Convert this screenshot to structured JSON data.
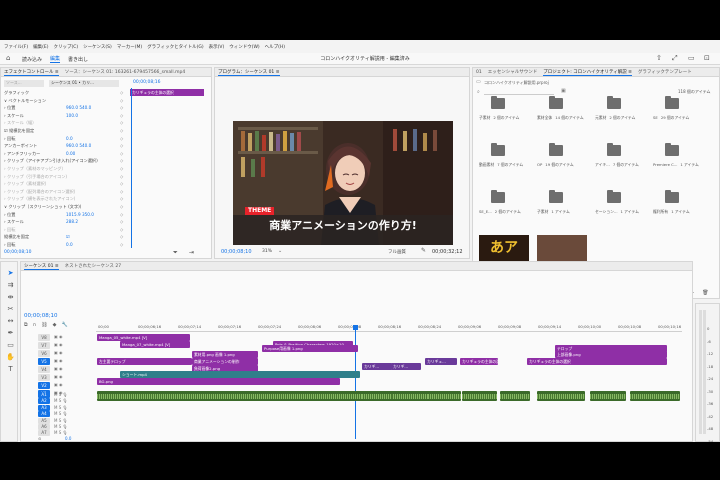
{
  "menu": [
    "ファイル(F)",
    "編集(E)",
    "クリップ(C)",
    "シーケンス(S)",
    "マーカー(M)",
    "グラフィックとタイトル(G)",
    "表示(V)",
    "ウィンドウ(W)",
    "ヘルプ(H)"
  ],
  "workspace_tabs": [
    "読み込み",
    "編集",
    "書き出し"
  ],
  "workspace_active": "編集",
  "document_title": "コロンハイクオリティ解説用 - 編集済み",
  "effect_controls": {
    "tabs": [
      "エフェクトコントロール ≡",
      "ソース：シーケンス 01: 163261-679457566_small.mp4"
    ],
    "sequence_chip": "シーケンス 01 • カリ...",
    "source_chip": "ソース...",
    "timecode": "00;00;08;16",
    "clip_bar_label": "カリギュラの主体の選択",
    "rows": [
      {
        "label": "グラフィック",
        "value": "",
        "dim": false
      },
      {
        "label": "∨ ベクトルモーション",
        "value": "",
        "dim": false
      },
      {
        "label": "  › 位置",
        "value": "960.0   540.0",
        "dim": false
      },
      {
        "label": "  › スケール",
        "value": "100.0",
        "dim": false
      },
      {
        "label": "  › スケール（幅）",
        "value": "",
        "dim": true
      },
      {
        "label": "     ☑ 縦横比を固定",
        "value": "",
        "dim": false
      },
      {
        "label": "  › 回転",
        "value": "0.0",
        "dim": false
      },
      {
        "label": "    アンカーポイント",
        "value": "960.0   540.0",
        "dim": false
      },
      {
        "label": "  › アンチフリッカー",
        "value": "0.00",
        "dim": false
      },
      {
        "label": "› クリップ（アイテアプン引き入れ(アイコン選択)",
        "value": "",
        "dim": false
      },
      {
        "label": "› クリップ（素材のマッピング）",
        "value": "",
        "dim": true
      },
      {
        "label": "› クリップ（引手場合のアイコン)",
        "value": "",
        "dim": true
      },
      {
        "label": "› クリップ（素材選択)",
        "value": "",
        "dim": true
      },
      {
        "label": "› クリップ（配列場合のアイコン選択)",
        "value": "",
        "dim": true
      },
      {
        "label": "› クリップ（横を表示されたアイコン)",
        "value": "",
        "dim": true
      },
      {
        "label": "∨ クリップ（スクリーンショット (文字))",
        "value": "",
        "dim": false
      },
      {
        "label": "  › 位置",
        "value": "1015.9   350.0",
        "dim": false
      },
      {
        "label": "  › スケール",
        "value": "288.2",
        "dim": false
      },
      {
        "label": "  › 回転",
        "value": "",
        "dim": true
      },
      {
        "label": "     縦横比を固定",
        "value": "☑",
        "dim": false
      },
      {
        "label": "  › 回転",
        "value": "0.0",
        "dim": false
      }
    ],
    "footer_timecode": "00;00;08;10"
  },
  "program": {
    "tab": "プログラム：シーケンス 01 ≡",
    "badge": "THEME",
    "caption": "商業アニメーションの作り方!",
    "current_timecode": "00;00;08;10",
    "zoom": "31%",
    "quality": "フル画質",
    "duration": "00;00;32;12"
  },
  "project": {
    "tabs": [
      "01",
      "エッセンシャルサウンド",
      "プロジェクト: コロンハイクオリティ解説 ≡",
      "グラフィックテンプレート"
    ],
    "path": "コロンハイクオリティ解説用.prproj",
    "count": "118 個のアイテム",
    "items": [
      {
        "name": "子素材",
        "count": "2 個のアイテム"
      },
      {
        "name": "素材全体",
        "count": "14 個のアイテム"
      },
      {
        "name": "元素材",
        "count": "2 個のアイテム"
      },
      {
        "name": "SE",
        "count": "29 個のアイテム"
      },
      {
        "name": "動画素材",
        "count": "7 個のアイテム"
      },
      {
        "name": "OP",
        "count": "19 個のアイテム"
      },
      {
        "name": "アイキ...",
        "count": "7 個のアイテム"
      },
      {
        "name": "Premiere C...",
        "count": "1 アイテム"
      },
      {
        "name": "SE_E...",
        "count": "2 個のアイテム"
      },
      {
        "name": "子素材",
        "count": "1 アイテム"
      },
      {
        "name": "セーション...",
        "count": "1 アイテム"
      },
      {
        "name": "権利所有",
        "count": "1 アイテム"
      },
      {
        "name": "テキストスタイル",
        "count": ""
      },
      {
        "name": "シーケンス 01.0...",
        "count": "0;29"
      }
    ]
  },
  "timeline": {
    "tabs": [
      "シーケンス 01 ≡",
      "ネストされたシーケンス 27"
    ],
    "timecode": "00;00;08;10",
    "ruler": [
      "00;00",
      "00;00;06;16",
      "00;00;07;14",
      "00;00;07;16",
      "00;00;07;24",
      "00;00;08;06",
      "00;00;08;08",
      "00;00;08;16",
      "00;00;08;24",
      "00;00;09;06",
      "00;00;09;08",
      "00;00;09;14",
      "00;00;10;00",
      "00;00;10;08",
      "00;00;10;16"
    ],
    "video_tracks": [
      "V8",
      "V7",
      "V6",
      "V5",
      "V4",
      "V3",
      "V2",
      "V1"
    ],
    "audio_tracks": [
      "A1",
      "A2",
      "A3",
      "A4",
      "A5",
      "A6",
      "A7"
    ],
    "master": "0.0",
    "clips": {
      "c1": "Manga_05_white.mp4 [V]",
      "c2": "Manga_07_white.mp4 [V]",
      "c3": "Pots & Position Characters 1920×10...",
      "c4": "素材用.png 画像 1.png",
      "c5": "Purpose用画像 1.png",
      "c6": "商業アニメーションの制作",
      "c7": "負荷画像2.png",
      "c8": "ショート.mp4",
      "c9": "BG.png",
      "c10": "カリギ...",
      "c11": "カリギ...",
      "c12": "カリギュ...",
      "c13": "カリギュラの主体の選択",
      "c14": "カリギュラの主体の選択",
      "c15": "テロップ",
      "c16": "上部画像.png",
      "c17": "左主要テロップ"
    }
  },
  "meter": [
    "0",
    "-6",
    "-12",
    "-18",
    "-24",
    "-30",
    "-36",
    "-42",
    "-48",
    "-54"
  ],
  "colors": {
    "accent": "#1473e6",
    "clip_purple": "#8f2fa6",
    "clip_teal": "#2f7f8a",
    "audio": "#3b6a2a"
  }
}
